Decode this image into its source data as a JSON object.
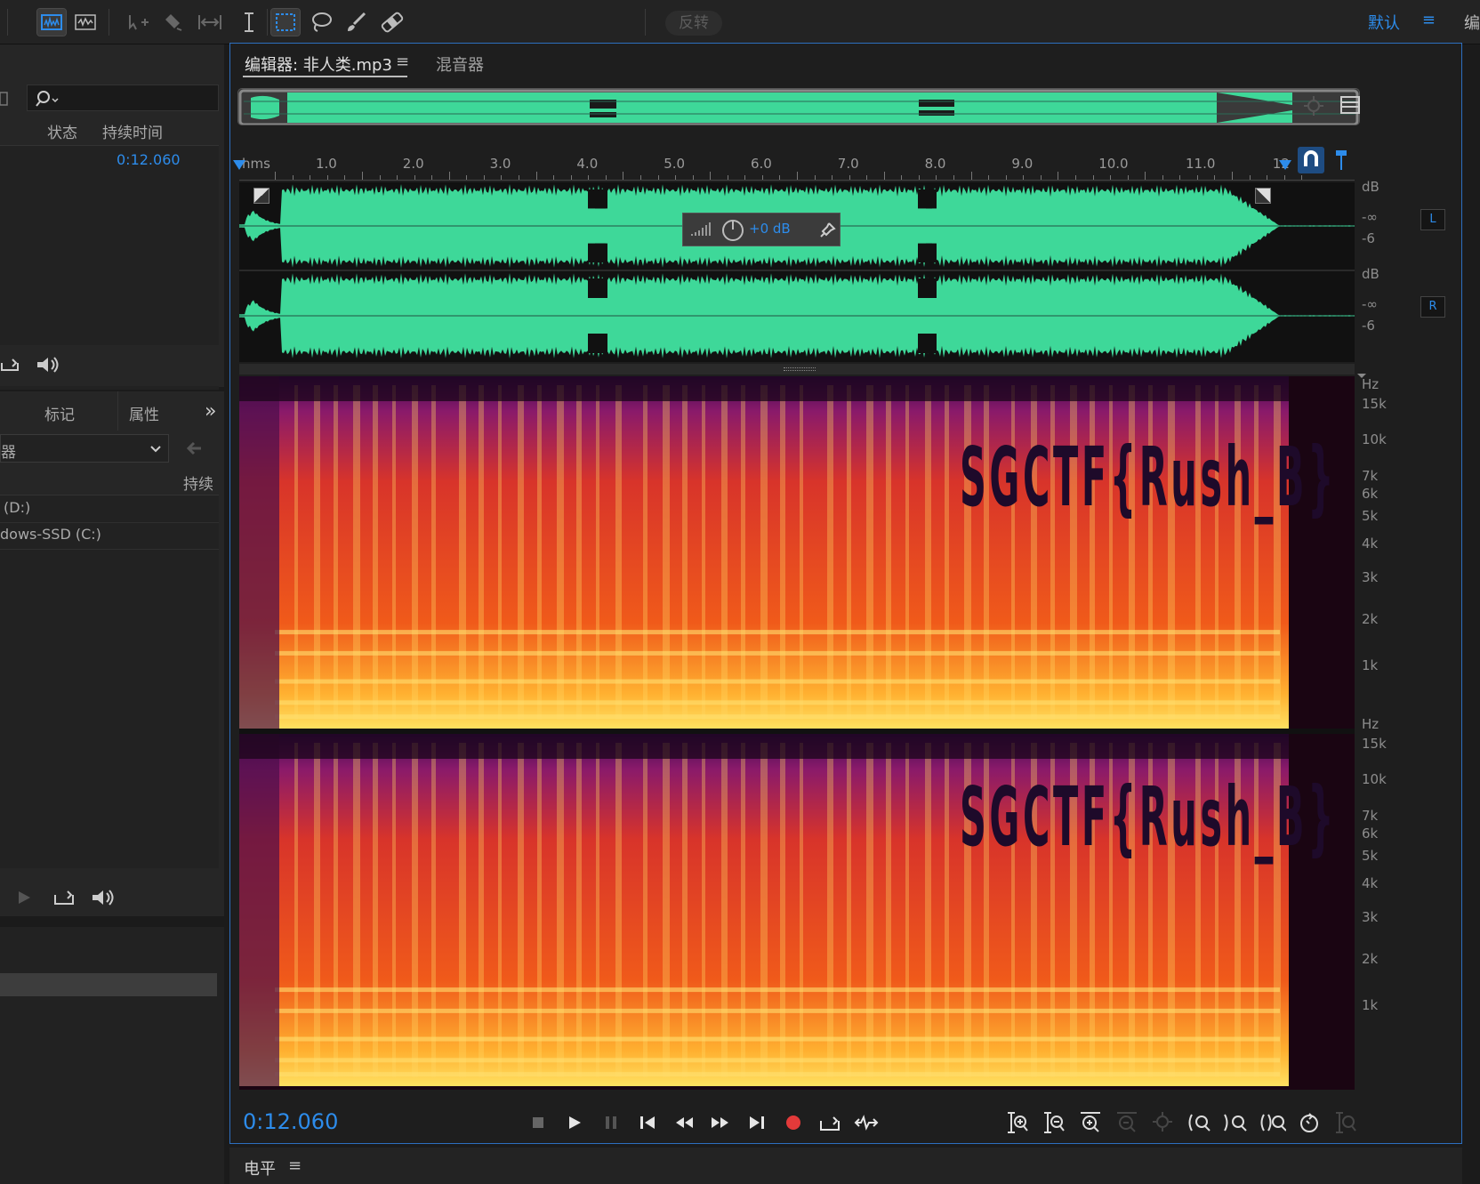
{
  "toolbar": {
    "reverse_label": "反转",
    "workspace_label": "默认",
    "workspace_menu": "≡",
    "right_cut_label": "编"
  },
  "files_panel": {
    "search_placeholder": "",
    "col_status": "状态",
    "col_duration": "持续时间",
    "file_duration": "0:12.060"
  },
  "media_panel": {
    "tab_markers": "标记",
    "tab_properties": "属性",
    "more_icon": "»",
    "dropdown_value": "器",
    "col_duration_partial": "持续",
    "drives": [
      "(D:)",
      "dows-SSD (C:)"
    ]
  },
  "editor": {
    "tab_editor": "编辑器: 非人类.mp3",
    "tab_menu": "≡",
    "tab_mixer": "混音器",
    "ruler": {
      "unit": "hms",
      "labels": [
        "1.0",
        "2.0",
        "3.0",
        "4.0",
        "5.0",
        "6.0",
        "7.0",
        "8.0",
        "9.0",
        "10.0",
        "11.0",
        "12"
      ]
    },
    "hud_gain": "+0 dB",
    "wave_scale_L": {
      "unit": "dB",
      "labels": [
        "-∞",
        "-6"
      ],
      "channel": "L"
    },
    "wave_scale_R": {
      "unit": "dB",
      "labels": [
        "-∞",
        "-6"
      ],
      "channel": "R"
    },
    "spec_scale": {
      "unit": "Hz",
      "labels": [
        "15k",
        "10k",
        "7k",
        "6k",
        "5k",
        "4k",
        "3k",
        "2k",
        "1k"
      ]
    },
    "hidden_text": "SGCTF{Rush_B}",
    "timecode": "0:12.060"
  },
  "levels_panel": {
    "title": "电平",
    "menu": "≡"
  },
  "colors": {
    "accent": "#2d8ceb",
    "waveform": "#3ed899",
    "record": "#e33a3a"
  }
}
